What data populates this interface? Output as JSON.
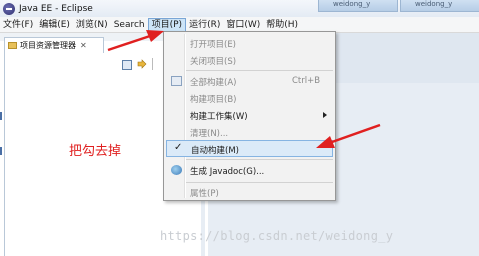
{
  "window": {
    "title": "Java EE - Eclipse",
    "tabs": [
      "weidong_y",
      "weidong_y"
    ]
  },
  "menubar": {
    "items": [
      {
        "label": "文件(F)"
      },
      {
        "label": "编辑(E)"
      },
      {
        "label": "浏览(N)"
      },
      {
        "label": "Search"
      },
      {
        "label": "项目(P)",
        "active": true
      },
      {
        "label": "运行(R)"
      },
      {
        "label": "窗口(W)"
      },
      {
        "label": "帮助(H)"
      }
    ]
  },
  "left_pane": {
    "tab_label": "项目资源管理器",
    "close_glyph": "✕"
  },
  "annotation": {
    "text": "把勾去掉",
    "color": "#e02020"
  },
  "project_menu": {
    "items": [
      {
        "label": "打开项目(E)",
        "enabled": false
      },
      {
        "label": "关闭项目(S)",
        "enabled": false
      },
      {
        "label": "全部构建(A)",
        "shortcut": "Ctrl+B",
        "enabled": false,
        "icon": "build-all-icon"
      },
      {
        "label": "构建项目(B)",
        "enabled": false
      },
      {
        "label": "构建工作集(W)",
        "enabled": true,
        "submenu": true
      },
      {
        "label": "清理(N)...",
        "enabled": false
      },
      {
        "label": "自动构建(M)",
        "enabled": true,
        "checked": true,
        "highlighted": true,
        "check_glyph": "✓"
      },
      {
        "label": "生成 Javadoc(G)...",
        "enabled": true,
        "icon": "javadoc-icon"
      },
      {
        "label": "属性(P)",
        "enabled": false
      }
    ]
  },
  "watermark": "https://blog.csdn.net/weidong_y",
  "colors": {
    "menu_highlight": "#dbeaf8",
    "arrow": "#e02020"
  }
}
